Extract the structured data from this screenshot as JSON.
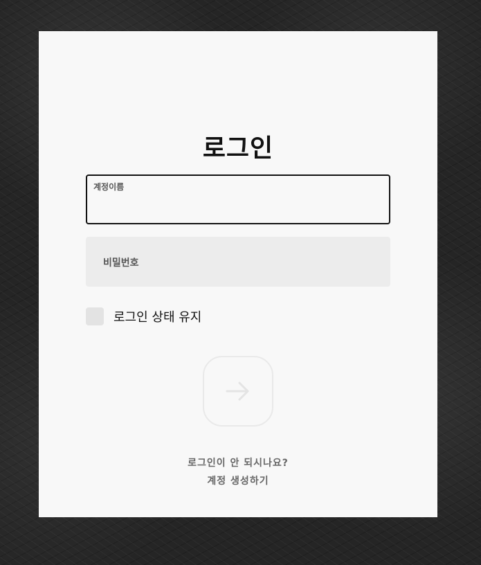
{
  "login": {
    "title": "로그인",
    "username_label": "계정이름",
    "username_value": "",
    "password_label": "비밀번호",
    "password_value": "",
    "remember_label": "로그인 상태 유지",
    "submit_icon": "arrow-right-icon",
    "help_link": "로그인이 안 되시나요?",
    "create_account_link": "계정 생성하기"
  },
  "colors": {
    "background": "#262626",
    "card": "#f8f8f8",
    "title": "#111111",
    "input_border_focus": "#111111",
    "input_fill": "#ececec",
    "checkbox_fill": "#e3e3e3",
    "button_border": "#e9e9e9",
    "arrow": "#e4e4e4",
    "link_text": "#666666"
  }
}
